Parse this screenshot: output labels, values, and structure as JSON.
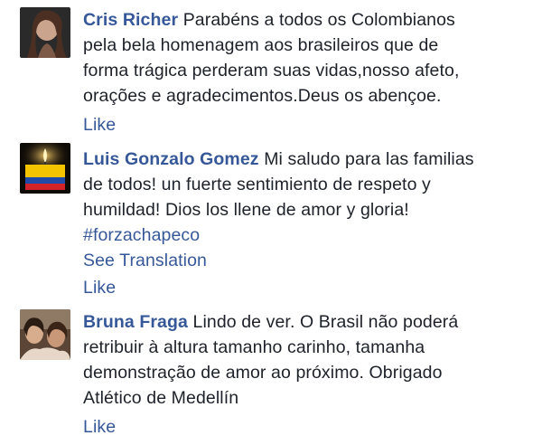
{
  "comments": [
    {
      "author": "Cris Richer",
      "lines": [
        "Parabéns a todos os Colombianos",
        "pela bela homenagem aos brasileiros que de",
        "forma trágica perderam suas vidas,nosso afeto,",
        "orações e agradecimentos.Deus os abençoe."
      ],
      "like_label": "Like",
      "avatar_icon": "woman-portrait-avatar"
    },
    {
      "author": "Luis Gonzalo Gomez",
      "lines": [
        "Mi saludo para las familias",
        "de todos! un fuerte sentimiento de respeto y",
        "humildad! Dios los llene de amor y gloria!"
      ],
      "hashtag": "#forzachapeco",
      "see_translation": "See Translation",
      "like_label": "Like",
      "avatar_icon": "candle-colombia-flag-avatar"
    },
    {
      "author": "Bruna Fraga",
      "lines": [
        "Lindo de ver. O Brasil não poderá",
        "retribuir à altura tamanho carinho, tamanha",
        "demonstração de amor ao próximo. Obrigado",
        "Atlético de Medellín"
      ],
      "like_label": "Like",
      "avatar_icon": "people-photo-avatar"
    }
  ],
  "colors": {
    "link": "#365899",
    "text": "#1d2129",
    "flag_yellow": "#f5c400",
    "flag_blue": "#1f4aa8",
    "flag_red": "#d2232a"
  }
}
